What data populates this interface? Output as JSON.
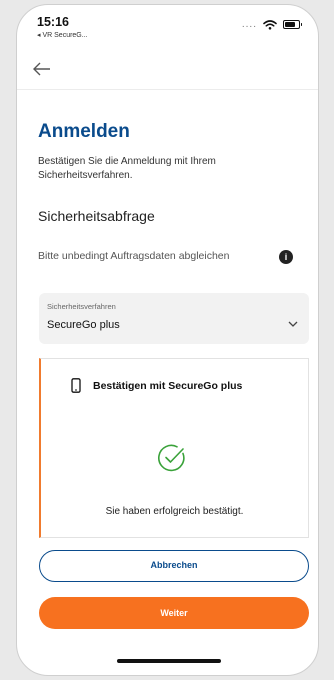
{
  "status_bar": {
    "time": "15:16",
    "back_app_label": "◂ VR SecureG...",
    "signal_dots": "....",
    "icons": [
      "wifi-icon",
      "battery-icon"
    ]
  },
  "nav": {
    "back_icon": "arrow-left-icon"
  },
  "page": {
    "title": "Anmelden",
    "intro": "Bestätigen Sie die Anmeldung mit Ihrem Sicherheitsverfahren.",
    "section_title": "Sicherheitsabfrage",
    "hint": "Bitte unbedingt Auftragsdaten abgleichen",
    "info_icon_glyph": "i"
  },
  "method_select": {
    "label": "Sicherheitsverfahren",
    "value": "SecureGo plus"
  },
  "confirm_card": {
    "title": "Bestätigen mit SecureGo plus",
    "success_text": "Sie haben erfolgreich bestätigt.",
    "icons": [
      "smartphone-icon",
      "check-circle-icon"
    ]
  },
  "buttons": {
    "cancel_label": "Abbrechen",
    "continue_label": "Weiter"
  },
  "colors": {
    "primary_blue": "#0a4b8c",
    "accent_orange": "#f7711f",
    "success_green": "#3aa23a"
  }
}
